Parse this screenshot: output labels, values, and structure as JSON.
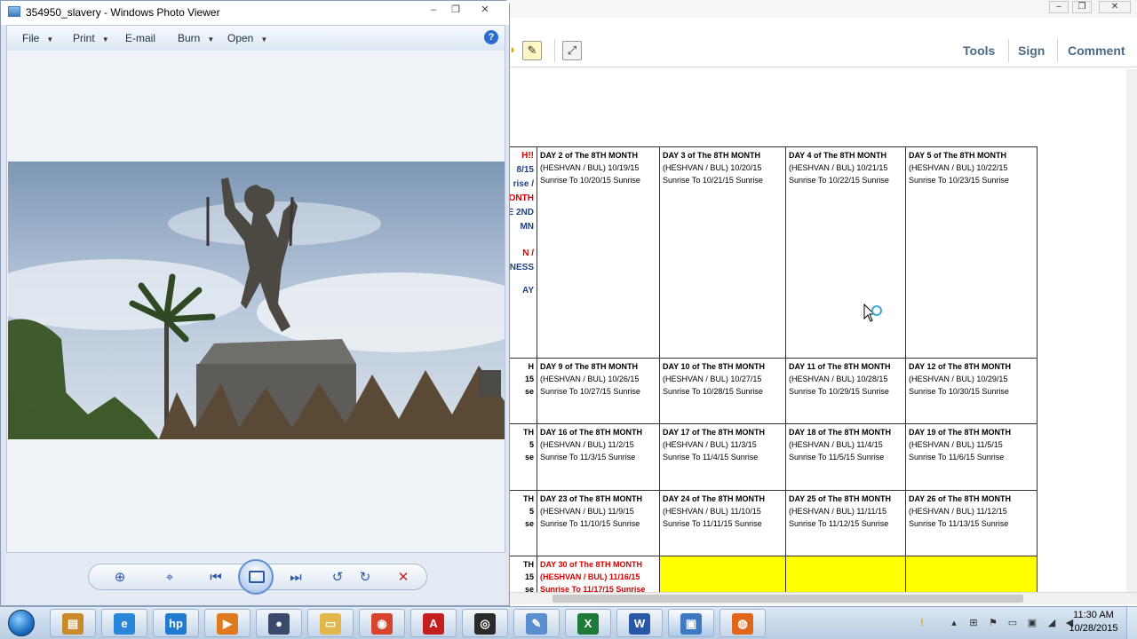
{
  "photo_viewer": {
    "title": "354950_slavery - Windows Photo Viewer",
    "menu": [
      {
        "label": "File",
        "has_dropdown": true
      },
      {
        "label": "Print",
        "has_dropdown": true
      },
      {
        "label": "E-mail",
        "has_dropdown": false
      },
      {
        "label": "Burn",
        "has_dropdown": true
      },
      {
        "label": "Open",
        "has_dropdown": true
      }
    ],
    "help_glyph": "?",
    "controls": {
      "zoom": "zoom-icon",
      "actual_size": "actual-size-icon",
      "previous": "previous-icon",
      "slideshow": "slideshow-icon",
      "next": "next-icon",
      "rotate_ccw": "rotate-counterclockwise-icon",
      "rotate_cw": "rotate-clockwise-icon",
      "delete": "delete-icon"
    }
  },
  "acrobat": {
    "toolbar_tabs": [
      "Tools",
      "Sign",
      "Comment"
    ],
    "calendar": {
      "rows": [
        {
          "left_fragments": [
            "H!!",
            "8/15",
            "rise /",
            "ONTH",
            "E 2ND",
            "MN",
            "N /",
            "NESS",
            "AY"
          ],
          "left_colors": [
            "#d40000",
            "#1f3f7f",
            "#1f3f7f",
            "#d40000",
            "#1f3f7f",
            "#1f3f7f",
            "#d40000",
            "#1f3f7f",
            "#1f3f7f"
          ],
          "cells": [
            {
              "head": "DAY 2 of The 8TH MONTH",
              "l1": "(HESHVAN / BUL) 10/19/15",
              "l2": "Sunrise To 10/20/15 Sunrise"
            },
            {
              "head": "DAY 3 of The 8TH MONTH",
              "l1": "(HESHVAN / BUL) 10/20/15",
              "l2": "Sunrise To 10/21/15 Sunrise"
            },
            {
              "head": "DAY 4 of The 8TH MONTH",
              "l1": "(HESHVAN / BUL) 10/21/15",
              "l2": "Sunrise To 10/22/15 Sunrise"
            },
            {
              "head": "DAY 5 of The 8TH MONTH",
              "l1": "(HESHVAN / BUL) 10/22/15",
              "l2": "Sunrise To 10/23/15 Sunrise"
            }
          ]
        },
        {
          "left_fragments": [
            "H",
            "15",
            "se"
          ],
          "cells": [
            {
              "head": "DAY 9 of The 8TH MONTH",
              "l1": "(HESHVAN / BUL) 10/26/15",
              "l2": "Sunrise To 10/27/15 Sunrise"
            },
            {
              "head": "DAY 10 of The 8TH MONTH",
              "l1": "(HESHVAN / BUL) 10/27/15",
              "l2": "Sunrise To 10/28/15 Sunrise"
            },
            {
              "head": "DAY 11 of The 8TH MONTH",
              "l1": "(HESHVAN / BUL) 10/28/15",
              "l2": "Sunrise To 10/29/15 Sunrise"
            },
            {
              "head": "DAY 12 of The 8TH MONTH",
              "l1": "(HESHVAN / BUL) 10/29/15",
              "l2": "Sunrise To 10/30/15 Sunrise"
            }
          ]
        },
        {
          "left_fragments": [
            "TH",
            "5",
            "se"
          ],
          "cells": [
            {
              "head": "DAY 16 of The 8TH MONTH",
              "l1": "(HESHVAN / BUL) 11/2/15",
              "l2": "Sunrise To 11/3/15 Sunrise"
            },
            {
              "head": "DAY 17 of The 8TH MONTH",
              "l1": "(HESHVAN / BUL) 11/3/15",
              "l2": "Sunrise To 11/4/15 Sunrise"
            },
            {
              "head": "DAY 18 of The 8TH MONTH",
              "l1": "(HESHVAN / BUL) 11/4/15",
              "l2": "Sunrise To 11/5/15 Sunrise"
            },
            {
              "head": "DAY 19 of The 8TH MONTH",
              "l1": "(HESHVAN / BUL) 11/5/15",
              "l2": "Sunrise To 11/6/15 Sunrise"
            }
          ]
        },
        {
          "left_fragments": [
            "TH",
            "5",
            "se"
          ],
          "cells": [
            {
              "head": "DAY 23 of The 8TH MONTH",
              "l1": "(HESHVAN / BUL) 11/9/15",
              "l2": "Sunrise To 11/10/15 Sunrise"
            },
            {
              "head": "DAY 24 of The 8TH MONTH",
              "l1": "(HESHVAN / BUL) 11/10/15",
              "l2": "Sunrise To 11/11/15 Sunrise"
            },
            {
              "head": "DAY 25 of The 8TH MONTH",
              "l1": "(HESHVAN / BUL) 11/11/15",
              "l2": "Sunrise To 11/12/15 Sunrise"
            },
            {
              "head": "DAY 26 of The 8TH MONTH",
              "l1": "(HESHVAN / BUL) 11/12/15",
              "l2": "Sunrise To 11/13/15 Sunrise"
            }
          ]
        },
        {
          "left_fragments": [
            "TH",
            "15",
            "se"
          ],
          "cells": [
            {
              "head": "DAY 30 of The 8TH MONTH",
              "l1": "(HESHVAN / BUL) 11/16/15",
              "l2": "Sunrise To 11/17/15 Sunrise",
              "red": true
            },
            {
              "head": "",
              "l1": "",
              "l2": "",
              "yellow": true
            },
            {
              "head": "",
              "l1": "",
              "l2": "",
              "yellow": true
            },
            {
              "head": "",
              "l1": "",
              "l2": "",
              "yellow": true
            }
          ]
        }
      ]
    }
  },
  "taskbar": {
    "start": "windows-start-icon",
    "pinned": [
      "file-manager-icon",
      "internet-explorer-icon",
      "hp-icon",
      "media-player-icon",
      "video-recorder-icon",
      "folder-icon",
      "chrome-icon",
      "acrobat-icon",
      "camtasia-icon",
      "paint-icon",
      "excel-icon",
      "word-icon",
      "photo-viewer-icon",
      "firefox-icon"
    ],
    "clock": {
      "time": "11:30 AM",
      "date": "10/28/2015"
    }
  },
  "colors": {
    "acrobat_tab": "#4a6a86",
    "highlight_yellow": "#ffff00",
    "red_text": "#d40000",
    "navy_text": "#1f3f7f",
    "taskbar": "#c7d8ea"
  }
}
